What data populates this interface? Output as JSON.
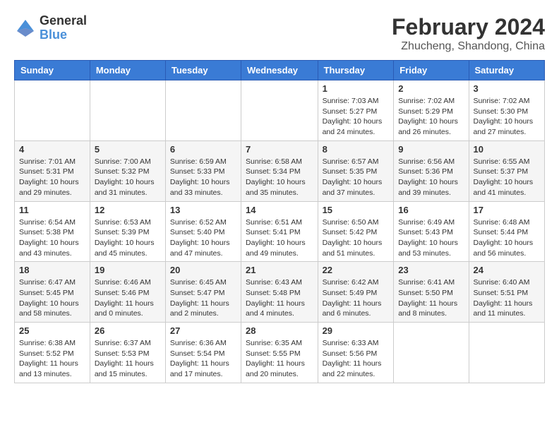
{
  "logo": {
    "text_general": "General",
    "text_blue": "Blue"
  },
  "title": "February 2024",
  "subtitle": "Zhucheng, Shandong, China",
  "weekdays": [
    "Sunday",
    "Monday",
    "Tuesday",
    "Wednesday",
    "Thursday",
    "Friday",
    "Saturday"
  ],
  "weeks": [
    [
      {
        "day": "",
        "info": ""
      },
      {
        "day": "",
        "info": ""
      },
      {
        "day": "",
        "info": ""
      },
      {
        "day": "",
        "info": ""
      },
      {
        "day": "1",
        "sunrise": "7:03 AM",
        "sunset": "5:27 PM",
        "daylight": "10 hours and 24 minutes."
      },
      {
        "day": "2",
        "sunrise": "7:02 AM",
        "sunset": "5:29 PM",
        "daylight": "10 hours and 26 minutes."
      },
      {
        "day": "3",
        "sunrise": "7:02 AM",
        "sunset": "5:30 PM",
        "daylight": "10 hours and 27 minutes."
      }
    ],
    [
      {
        "day": "4",
        "sunrise": "7:01 AM",
        "sunset": "5:31 PM",
        "daylight": "10 hours and 29 minutes."
      },
      {
        "day": "5",
        "sunrise": "7:00 AM",
        "sunset": "5:32 PM",
        "daylight": "10 hours and 31 minutes."
      },
      {
        "day": "6",
        "sunrise": "6:59 AM",
        "sunset": "5:33 PM",
        "daylight": "10 hours and 33 minutes."
      },
      {
        "day": "7",
        "sunrise": "6:58 AM",
        "sunset": "5:34 PM",
        "daylight": "10 hours and 35 minutes."
      },
      {
        "day": "8",
        "sunrise": "6:57 AM",
        "sunset": "5:35 PM",
        "daylight": "10 hours and 37 minutes."
      },
      {
        "day": "9",
        "sunrise": "6:56 AM",
        "sunset": "5:36 PM",
        "daylight": "10 hours and 39 minutes."
      },
      {
        "day": "10",
        "sunrise": "6:55 AM",
        "sunset": "5:37 PM",
        "daylight": "10 hours and 41 minutes."
      }
    ],
    [
      {
        "day": "11",
        "sunrise": "6:54 AM",
        "sunset": "5:38 PM",
        "daylight": "10 hours and 43 minutes."
      },
      {
        "day": "12",
        "sunrise": "6:53 AM",
        "sunset": "5:39 PM",
        "daylight": "10 hours and 45 minutes."
      },
      {
        "day": "13",
        "sunrise": "6:52 AM",
        "sunset": "5:40 PM",
        "daylight": "10 hours and 47 minutes."
      },
      {
        "day": "14",
        "sunrise": "6:51 AM",
        "sunset": "5:41 PM",
        "daylight": "10 hours and 49 minutes."
      },
      {
        "day": "15",
        "sunrise": "6:50 AM",
        "sunset": "5:42 PM",
        "daylight": "10 hours and 51 minutes."
      },
      {
        "day": "16",
        "sunrise": "6:49 AM",
        "sunset": "5:43 PM",
        "daylight": "10 hours and 53 minutes."
      },
      {
        "day": "17",
        "sunrise": "6:48 AM",
        "sunset": "5:44 PM",
        "daylight": "10 hours and 56 minutes."
      }
    ],
    [
      {
        "day": "18",
        "sunrise": "6:47 AM",
        "sunset": "5:45 PM",
        "daylight": "10 hours and 58 minutes."
      },
      {
        "day": "19",
        "sunrise": "6:46 AM",
        "sunset": "5:46 PM",
        "daylight": "11 hours and 0 minutes."
      },
      {
        "day": "20",
        "sunrise": "6:45 AM",
        "sunset": "5:47 PM",
        "daylight": "11 hours and 2 minutes."
      },
      {
        "day": "21",
        "sunrise": "6:43 AM",
        "sunset": "5:48 PM",
        "daylight": "11 hours and 4 minutes."
      },
      {
        "day": "22",
        "sunrise": "6:42 AM",
        "sunset": "5:49 PM",
        "daylight": "11 hours and 6 minutes."
      },
      {
        "day": "23",
        "sunrise": "6:41 AM",
        "sunset": "5:50 PM",
        "daylight": "11 hours and 8 minutes."
      },
      {
        "day": "24",
        "sunrise": "6:40 AM",
        "sunset": "5:51 PM",
        "daylight": "11 hours and 11 minutes."
      }
    ],
    [
      {
        "day": "25",
        "sunrise": "6:38 AM",
        "sunset": "5:52 PM",
        "daylight": "11 hours and 13 minutes."
      },
      {
        "day": "26",
        "sunrise": "6:37 AM",
        "sunset": "5:53 PM",
        "daylight": "11 hours and 15 minutes."
      },
      {
        "day": "27",
        "sunrise": "6:36 AM",
        "sunset": "5:54 PM",
        "daylight": "11 hours and 17 minutes."
      },
      {
        "day": "28",
        "sunrise": "6:35 AM",
        "sunset": "5:55 PM",
        "daylight": "11 hours and 20 minutes."
      },
      {
        "day": "29",
        "sunrise": "6:33 AM",
        "sunset": "5:56 PM",
        "daylight": "11 hours and 22 minutes."
      },
      {
        "day": "",
        "info": ""
      },
      {
        "day": "",
        "info": ""
      }
    ]
  ]
}
